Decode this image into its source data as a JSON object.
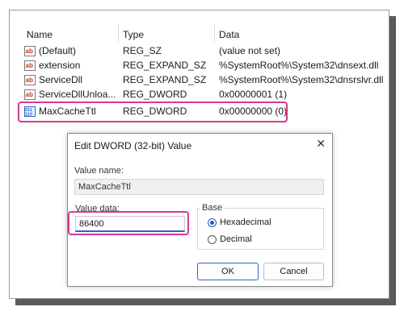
{
  "columns": {
    "name": "Name",
    "type": "Type",
    "data": "Data"
  },
  "rows": [
    {
      "icon": "string-value-icon",
      "name": "(Default)",
      "type": "REG_SZ",
      "data": "(value not set)"
    },
    {
      "icon": "string-value-icon",
      "name": "extension",
      "type": "REG_EXPAND_SZ",
      "data": "%SystemRoot%\\System32\\dnsext.dll"
    },
    {
      "icon": "string-value-icon",
      "name": "ServiceDll",
      "type": "REG_EXPAND_SZ",
      "data": "%SystemRoot%\\System32\\dnsrslvr.dll"
    },
    {
      "icon": "string-value-icon",
      "name": "ServiceDllUnloa...",
      "type": "REG_DWORD",
      "data": "0x00000001 (1)"
    },
    {
      "icon": "binary-value-icon",
      "name": "MaxCacheTtl",
      "type": "REG_DWORD",
      "data": "0x00000000 (0)"
    }
  ],
  "dialog": {
    "title": "Edit DWORD (32-bit) Value",
    "close_glyph": "✕",
    "value_name_label": "Value name:",
    "value_name": "MaxCacheTtl",
    "value_data_label": "Value data:",
    "value_data": "86400",
    "base_label": "Base",
    "radio_hex": "Hexadecimal",
    "radio_dec": "Decimal",
    "ok_label": "OK",
    "cancel_label": "Cancel"
  },
  "colors": {
    "highlight": "#d63a8e",
    "accent": "#2c63c6"
  }
}
